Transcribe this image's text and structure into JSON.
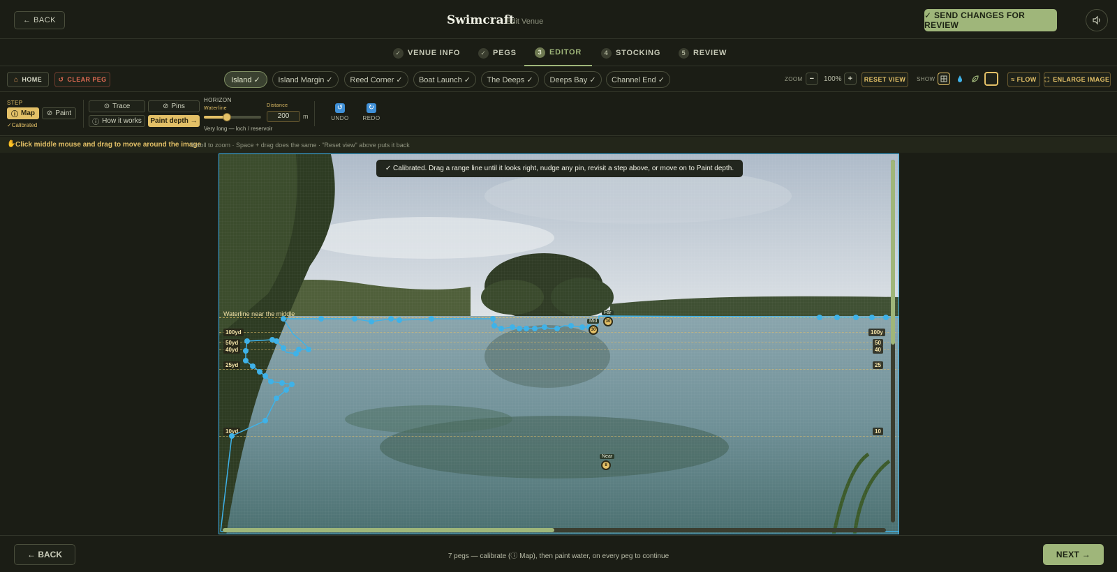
{
  "top": {
    "back": "← BACK",
    "brand": "Swimcraft",
    "subtitle": "Edit Venue",
    "send": "✓ SEND CHANGES FOR REVIEW"
  },
  "steps": [
    {
      "mark": "✓",
      "label": "VENUE INFO"
    },
    {
      "mark": "✓",
      "label": "PEGS"
    },
    {
      "mark": "3",
      "label": "EDITOR"
    },
    {
      "mark": "4",
      "label": "STOCKING"
    },
    {
      "mark": "5",
      "label": "REVIEW"
    }
  ],
  "toolbar": {
    "home": "HOME",
    "clear": "CLEAR PEG",
    "pegs": [
      "Island ✓",
      "Island Margin ✓",
      "Reed Corner ✓",
      "Boat Launch ✓",
      "The Deeps ✓",
      "Deeps Bay ✓",
      "Channel End ✓"
    ],
    "zoom_label": "ZOOM",
    "zoom_minus": "−",
    "zoom_value": "100%",
    "zoom_plus": "+",
    "reset_view": "RESET VIEW",
    "show_label": "SHOW",
    "flow": "≈ FLOW",
    "enlarge": "ENLARGE IMAGE"
  },
  "controls": {
    "step_label": "STEP",
    "map": "Map",
    "paint": "Paint",
    "calibrated": "✓Calibrated",
    "trace": "Trace",
    "pins": "Pins",
    "how": "How it works",
    "paint_depth": "Paint depth →",
    "horizon_label": "HORIZON",
    "waterline_label": "Waterline",
    "waterline_value": 0.4,
    "distance_label": "Distance",
    "distance_value": "200",
    "distance_unit": "m",
    "horizon_note": "Very long — loch / reservoir",
    "undo": "UNDO",
    "redo": "REDO"
  },
  "hint": {
    "main": "Click middle mouse and drag to move around the image",
    "detail": "Scroll to zoom · Space + drag does the same · \"Reset view\" above puts it back"
  },
  "canvas": {
    "banner": "✓ Calibrated. Drag a range line until it looks right, nudge any pin, revisit a step above, or move on to Paint depth.",
    "waterline_text": "Waterline near the middle",
    "ranges_left": [
      "100yd",
      "50yd",
      "40yd",
      "25yd",
      "10yd"
    ],
    "ranges_right": [
      "100y",
      "50",
      "40",
      "25",
      "10"
    ],
    "pins": [
      {
        "label": "Far",
        "value": "30"
      },
      {
        "label": "Mid",
        "value": "30"
      },
      {
        "label": "Near",
        "value": "8"
      }
    ]
  },
  "footer": {
    "back": "← BACK",
    "status": "7 pegs — calibrate (ⓘ Map), then paint water, on every peg to continue",
    "next": "NEXT →"
  }
}
